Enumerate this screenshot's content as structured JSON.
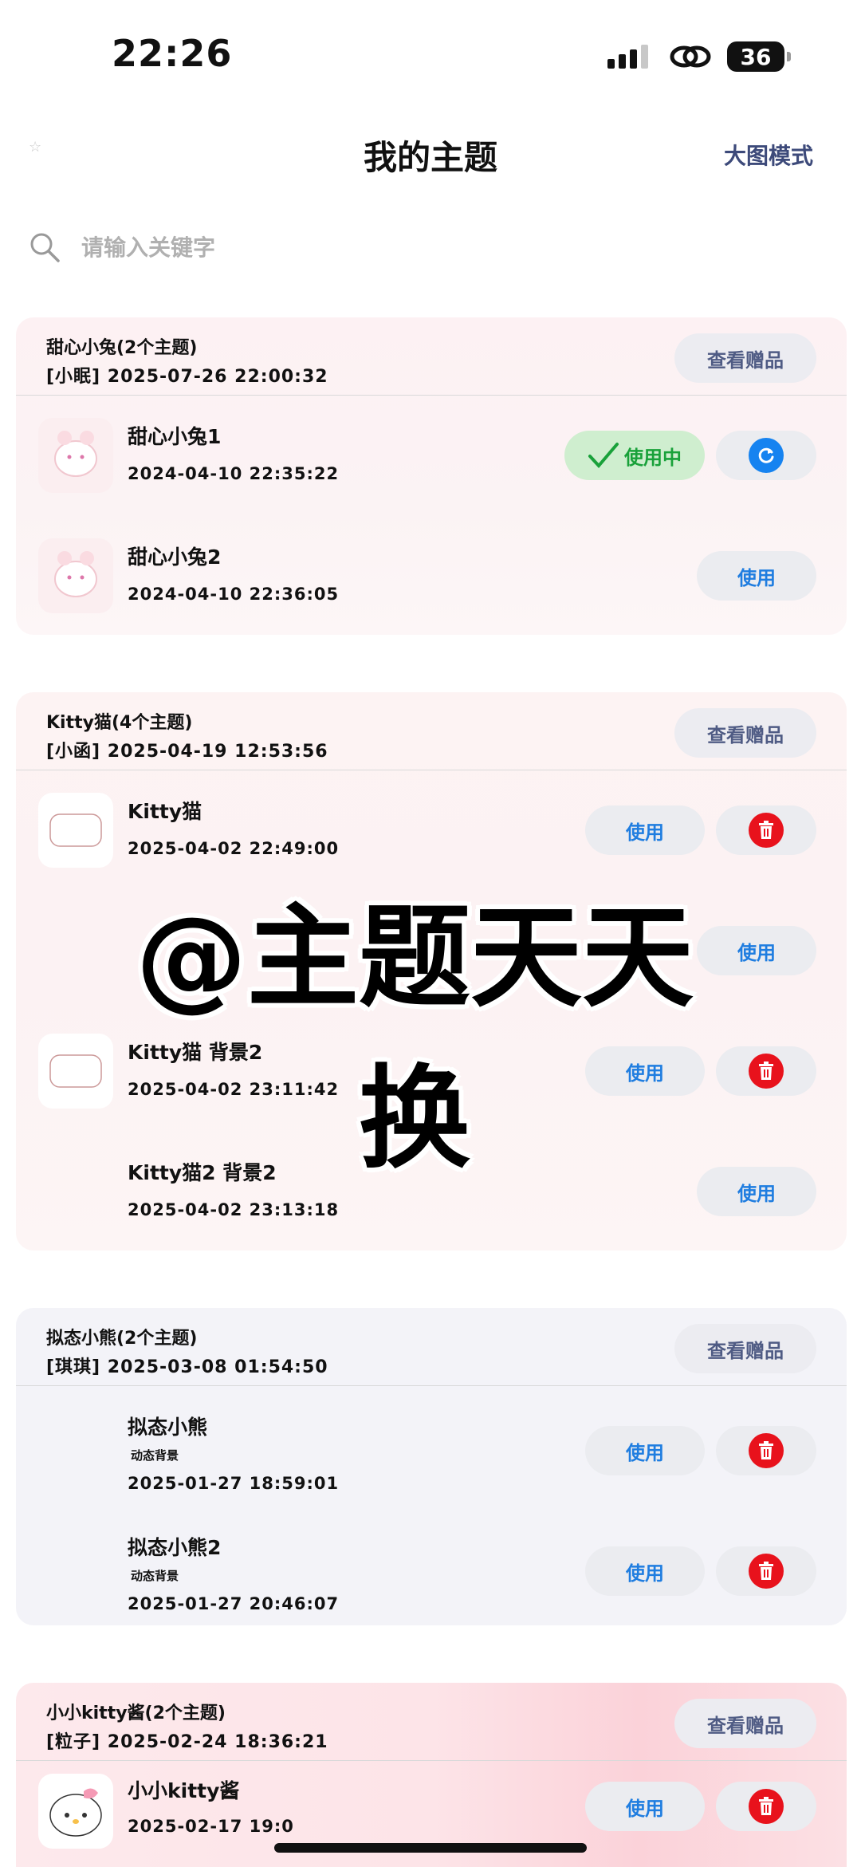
{
  "status": {
    "time": "22:26",
    "battery": "36"
  },
  "nav": {
    "back_icon": "star-icon",
    "title": "我的主题",
    "right_label": "大图模式"
  },
  "search": {
    "placeholder": "请输入关键字"
  },
  "colors": {
    "accent_blue": "#1683f0",
    "delete_red": "#e8121c",
    "in_use_green": "#19a13a",
    "gift_text": "#4f5b84"
  },
  "groups": [
    {
      "name": "甜心小兔(2个主题)",
      "meta": "[小眠]  2025-07-26 22:00:32",
      "gift_label": "查看赠品",
      "items": [
        {
          "name": "甜心小兔1",
          "date": "2024-04-10 22:35:22",
          "status": "使用中",
          "action_icon": "refresh-icon"
        },
        {
          "name": "甜心小兔2",
          "date": "2024-04-10 22:36:05",
          "button": "使用"
        }
      ]
    },
    {
      "name": "Kitty猫(4个主题)",
      "meta": "[小函]  2025-04-19 12:53:56",
      "gift_label": "查看赠品",
      "items": [
        {
          "name": "Kitty猫",
          "date": "2025-04-02 22:49:00",
          "button": "使用",
          "action_icon": "trash-icon"
        },
        {
          "button": "使用"
        },
        {
          "name": "Kitty猫 背景2",
          "date": "2025-04-02 23:11:42",
          "button": "使用",
          "action_icon": "trash-icon"
        },
        {
          "name": "Kitty猫2 背景2",
          "date": "2025-04-02 23:13:18",
          "button": "使用"
        }
      ]
    },
    {
      "name": "拟态小熊(2个主题)",
      "meta": "[琪琪]  2025-03-08 01:54:50",
      "gift_label": "查看赠品",
      "items": [
        {
          "name": "拟态小熊",
          "sub": "动态背景",
          "date": "2025-01-27 18:59:01",
          "button": "使用",
          "action_icon": "trash-icon"
        },
        {
          "name": "拟态小熊2",
          "sub": "动态背景",
          "date": "2025-01-27 20:46:07",
          "button": "使用",
          "action_icon": "trash-icon"
        }
      ]
    },
    {
      "name": "小小kitty酱(2个主题)",
      "meta": "[粒子]  2025-02-24 18:36:21",
      "gift_label": "查看赠品",
      "items": [
        {
          "name": "小小kitty酱",
          "date": "2025-02-17 19:0",
          "button": "使用",
          "action_icon": "trash-icon"
        }
      ]
    }
  ],
  "overlay_text": "@主题天天换"
}
